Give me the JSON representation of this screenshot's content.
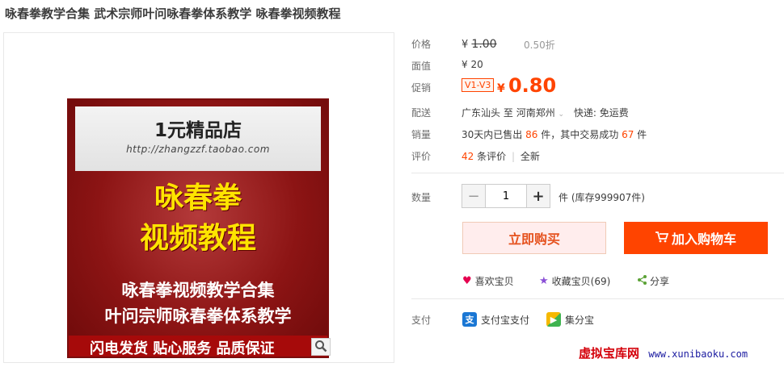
{
  "product": {
    "title": "咏春拳教学合集 武术宗师叶问咏春拳体系教学 咏春拳视频教程"
  },
  "poster": {
    "shop_name": "1元精品店",
    "shop_url": "http://zhangzzf.taobao.com",
    "headline_1": "咏春拳",
    "headline_2": "视频教程",
    "sub_1": "咏春拳视频教学合集",
    "sub_2": "叶问宗师咏春拳体系教学",
    "footer": "闪电发货 贴心服务 品质保证"
  },
  "price": {
    "label": "价格",
    "currency": "¥",
    "original": "1.00",
    "discount": "0.50折"
  },
  "face_value": {
    "label": "面值",
    "value": "¥ 20"
  },
  "promo": {
    "label": "促销",
    "tag": "V1-V3",
    "currency": "¥",
    "price": "0.80"
  },
  "delivery": {
    "label": "配送",
    "from": "广东汕头",
    "to_word": "至",
    "destination": "河南郑州",
    "shipping": "快递: 免运费"
  },
  "sales": {
    "label": "销量",
    "prefix": "30天内已售出",
    "sold": "86",
    "mid": "件，其中交易成功",
    "success": "67",
    "suffix": "件"
  },
  "reviews": {
    "label": "评价",
    "count": "42",
    "count_suffix": "条评价",
    "sep": "|",
    "tag": "全新"
  },
  "quantity": {
    "label": "数量",
    "value": "1",
    "minus": "−",
    "plus": "+",
    "stock": "件 (库存999907件)"
  },
  "actions": {
    "buy_now": "立即购买",
    "add_cart": "加入购物车"
  },
  "social": {
    "like": "喜欢宝贝",
    "favorite": "收藏宝贝(69)",
    "share": "分享"
  },
  "payment": {
    "label": "支付",
    "alipay": "支付宝支付",
    "jifenbao": "集分宝"
  },
  "watermark": {
    "name": "虚拟宝库网",
    "url": "www.xunibaoku.com"
  },
  "colors": {
    "accent": "#ff4400",
    "price_red": "#ff4400",
    "poster_red": "#8c1414",
    "headline_yellow": "#ffe400"
  }
}
